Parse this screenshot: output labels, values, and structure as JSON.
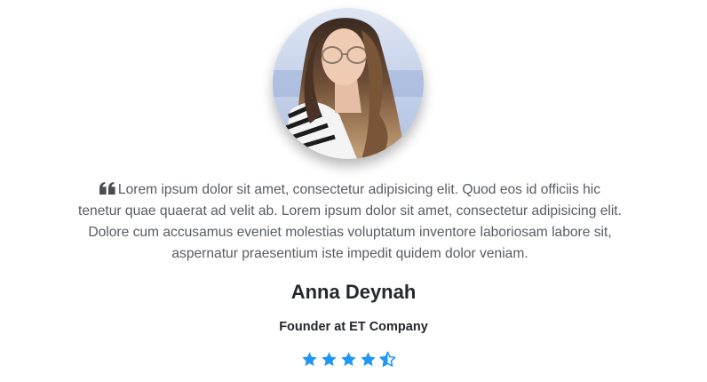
{
  "testimonial": {
    "avatar_alt": "Anna Deynah",
    "quote": "Lorem ipsum dolor sit amet, consectetur adipisicing elit. Quod eos id officiis hic tenetur quae quaerat ad velit ab. Lorem ipsum dolor sit amet, consectetur adipisicing elit. Dolore cum accusamus eveniet molestias voluptatum inventore laboriosam labore sit, aspernatur praesentium iste impedit quidem dolor veniam.",
    "quote_icon": "quote-left-icon",
    "name": "Anna Deynah",
    "role": "Founder at ET Company",
    "rating": {
      "value": 4.5,
      "max": 5,
      "icon": "star-icon",
      "color": "#2196f3"
    }
  }
}
